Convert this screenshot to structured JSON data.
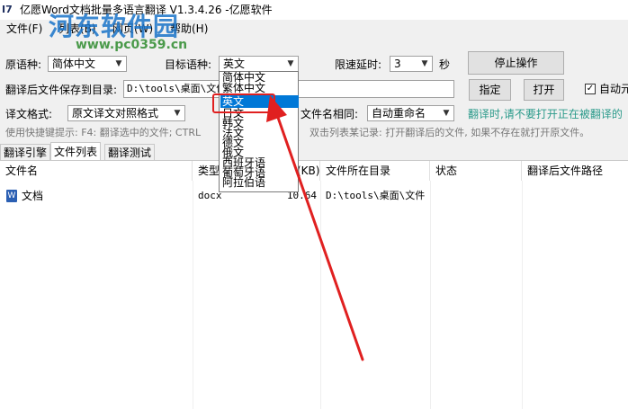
{
  "window": {
    "title": "亿愿Word文档批量多语言翻译 V1.3.4.26 -亿愿软件",
    "app_icon_text": "I7"
  },
  "watermark": {
    "brand": "河东软件园",
    "url": "www.pc0359.cn"
  },
  "menu": [
    {
      "label": "文件(F)"
    },
    {
      "label": "列表(B)"
    },
    {
      "label": "网页(W)"
    },
    {
      "label": "帮助(H)"
    }
  ],
  "settings": {
    "source_lang_label": "原语种:",
    "source_lang_value": "简体中文",
    "target_lang_label": "目标语种:",
    "target_lang_value": "英文",
    "delay_label": "限速延时:",
    "delay_value": "3",
    "delay_unit": "秒",
    "stop_button": "停止操作",
    "save_dir_label": "翻译后文件保存到目录:",
    "save_dir_value": "D:\\tools\\桌面\\文件",
    "specify_button": "指定",
    "open_button": "打开",
    "auto_checkbox_label": "自动元",
    "format_label": "译文格式:",
    "format_value": "原文译文对照格式",
    "same_name_label": "文件名相同:",
    "same_name_value": "自动重命名",
    "warning_text": "翻译时,请不要打开正在被翻译的"
  },
  "hint": {
    "left": "使用快捷键提示: F4: 翻译选中的文件; CTRL",
    "right": "双击列表某记录: 打开翻译后的文件, 如果不存在就打开原文件。"
  },
  "tabs": [
    {
      "label": "翻译引擎"
    },
    {
      "label": "文件列表"
    },
    {
      "label": "翻译测试"
    }
  ],
  "table": {
    "columns": [
      "文件名",
      "类型",
      "(KB)",
      "文件所在目录",
      "状态",
      "翻译后文件路径"
    ],
    "rows": [
      {
        "name": "文档",
        "type": "docx",
        "size": "10.64",
        "dir": "D:\\tools\\桌面\\文件",
        "status": "",
        "out": ""
      }
    ]
  },
  "dropdown": {
    "options": [
      "简体中文",
      "繁体中文",
      "英文",
      "日文",
      "韩文",
      "法文",
      "德文",
      "俄文",
      "西班牙语",
      "葡萄牙语",
      "阿拉伯语"
    ],
    "selected_index": 2
  },
  "annotation": {
    "color": "#e02020"
  }
}
